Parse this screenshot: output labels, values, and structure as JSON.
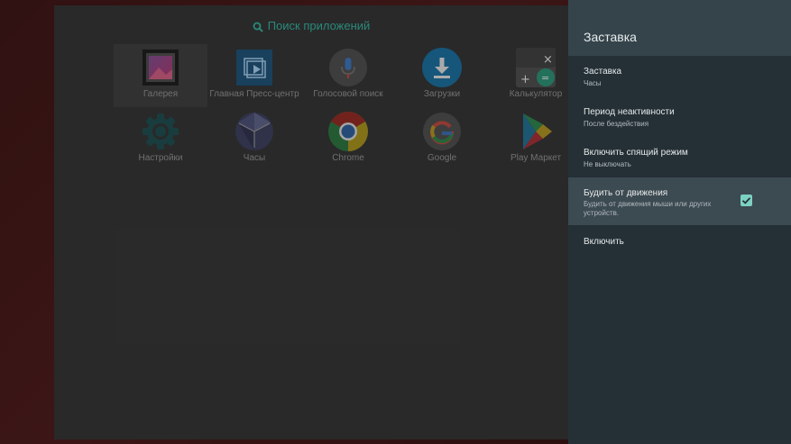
{
  "launcher": {
    "search_label": "Поиск приложений",
    "apps": [
      {
        "label": "Галерея",
        "icon": "gallery-icon"
      },
      {
        "label": "Главная Пресс-центр",
        "icon": "press-center-icon"
      },
      {
        "label": "Голосовой поиск",
        "icon": "microphone-icon"
      },
      {
        "label": "Загрузки",
        "icon": "download-icon"
      },
      {
        "label": "Калькулятор",
        "icon": "calculator-icon"
      },
      {
        "label": "Настройки",
        "icon": "settings-gear-icon"
      },
      {
        "label": "Часы",
        "icon": "clock-icon"
      },
      {
        "label": "Chrome",
        "icon": "chrome-icon"
      },
      {
        "label": "Google",
        "icon": "google-icon"
      },
      {
        "label": "Play Маркет",
        "icon": "play-market-icon"
      }
    ]
  },
  "settings": {
    "title": "Заставка",
    "items": [
      {
        "title": "Заставка",
        "subtitle": "Часы"
      },
      {
        "title": "Период неактивности",
        "subtitle": "После  бездействия"
      },
      {
        "title": "Включить спящий режим",
        "subtitle": "Не выключать"
      },
      {
        "title": "Будить от движения",
        "subtitle": "Будить от движения мыши или других устройств.",
        "checked": true
      },
      {
        "title": "Включить",
        "subtitle": ""
      }
    ]
  },
  "colors": {
    "accent": "#7cd1c3",
    "search": "#33a896",
    "panel": "#243036",
    "panel_header": "#35444b"
  }
}
